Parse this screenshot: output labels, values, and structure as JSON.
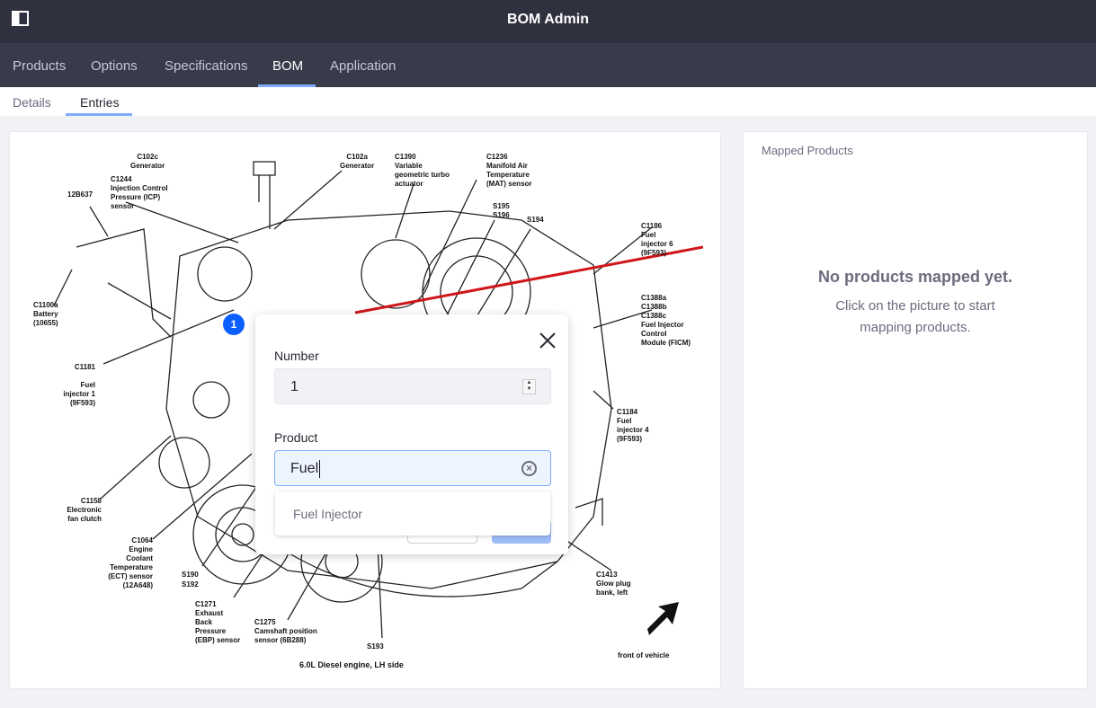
{
  "app": {
    "title": "BOM Admin"
  },
  "nav": {
    "items": [
      {
        "label": "Products"
      },
      {
        "label": "Options"
      },
      {
        "label": "Specifications"
      },
      {
        "label": "BOM",
        "active": true
      },
      {
        "label": "Application"
      }
    ]
  },
  "subnav": {
    "items": [
      {
        "label": "Details"
      },
      {
        "label": "Entries",
        "active": true
      }
    ]
  },
  "diagram": {
    "caption": "6.0L Diesel engine, LH side",
    "front_label": "front of vehicle",
    "labels": [
      "C102c\nGenerator",
      "C1244\nInjection Control\nPressure (ICP)\nsensor",
      "12B637",
      "C1100a\nBattery\n(10655)",
      "C102a\nGenerator",
      "C1390\nVariable\ngeometric turbo\nactuator",
      "C1236\nManifold Air\nTemperature\n(MAT) sensor",
      "S195\nS196",
      "S194",
      "C1186\nFuel\ninjector 6\n(9F593)",
      "C1388a\nC1388b\nC1388c\nFuel Injector\nControl\nModule (FICM)",
      "C1181\n\nFuel\ninjector 1\n(9F593)",
      "C1184\nFuel\ninjector 4\n(9F593)",
      "C1158\nElectronic\nfan clutch",
      "C1064\nEngine\nCoolant\nTemperature\n(ECT) sensor\n(12A648)",
      "S190\nS192",
      "C1271\nExhaust\nBack\nPressure\n(EBP) sensor",
      "C1275\nCamshaft position\nsensor (6B288)",
      "S193",
      "C1413\nGlow plug\nbank, left"
    ],
    "marker_number": "1",
    "line_color": "#d0161b"
  },
  "modal": {
    "number_label": "Number",
    "number_value": "1",
    "product_label": "Product",
    "product_value": "Fuel",
    "suggestions": [
      "Fuel Injector"
    ]
  },
  "mapped": {
    "title": "Mapped Products",
    "empty_title": "No products mapped yet.",
    "empty_text": "Click on the picture to start mapping products."
  },
  "colors": {
    "topbar": "#30313f",
    "navbar": "#393a4a",
    "accent": "#80acff",
    "marker": "#0b5fff"
  }
}
